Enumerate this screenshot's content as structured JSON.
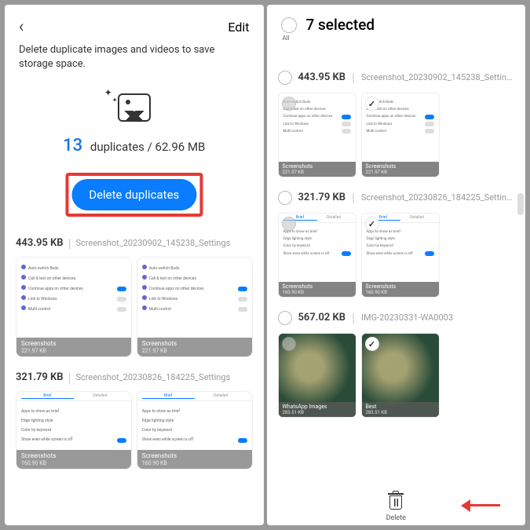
{
  "left": {
    "edit": "Edit",
    "subtitle": "Delete duplicate images and videos to save storage space.",
    "count": "13",
    "stats_text": "duplicates / 62.96 MB",
    "delete_btn": "Delete duplicates",
    "groups": [
      {
        "size": "443.95 KB",
        "filename": "Screenshot_20230902_145238_Settings",
        "album": "Screenshots",
        "thumb_sz": "221.97 KB",
        "rows": [
          "Auto switch Buds",
          "Call & text on other devices",
          "Continue apps on other devices",
          "Link to Windows",
          "Multi control"
        ]
      },
      {
        "size": "321.79 KB",
        "filename": "Screenshot_20230826_184225_Settings",
        "album": "Screenshots",
        "thumb_sz": "160.90 KB",
        "rows": [
          "Apps to show as brief",
          "Edge lighting style",
          "Color by keyword",
          "Show even while screen is off"
        ]
      }
    ]
  },
  "right": {
    "title": "7 selected",
    "all_label": "All",
    "groups": [
      {
        "size": "443.95 KB",
        "filename": "Screenshot_20230902_145238_Settings",
        "album": "Screenshots",
        "thumb_sz": "221.97 KB"
      },
      {
        "size": "321.79 KB",
        "filename": "Screenshot_20230826_184225_Settings",
        "album": "Screenshots",
        "thumb_sz": "160.90 KB"
      },
      {
        "size": "567.02 KB",
        "filename": "IMG-20230331-WA0003",
        "album1": "WhatsApp Images",
        "album2": "Best",
        "thumb_sz": "283.51 KB"
      }
    ],
    "delete_label": "Delete"
  }
}
